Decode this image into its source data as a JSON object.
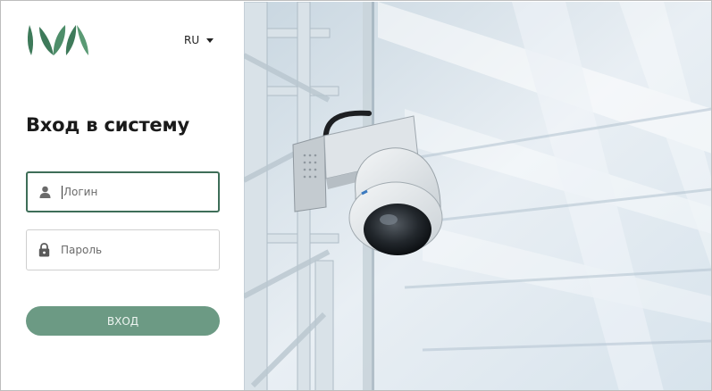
{
  "brand": {
    "logo_text": "IVA",
    "color": "#3e7a5a"
  },
  "language": {
    "selected": "RU"
  },
  "login": {
    "title": "Вход в систему",
    "username_placeholder": "Логин",
    "password_placeholder": "Пароль",
    "submit_label": "ВХОД"
  },
  "colors": {
    "accent": "#6c9a84",
    "active_border": "#3e6e58"
  },
  "icons": {
    "user": "user-icon",
    "lock": "lock-icon",
    "language_caret": "caret-down-icon"
  },
  "hero": {
    "subject": "security-camera-photo"
  }
}
